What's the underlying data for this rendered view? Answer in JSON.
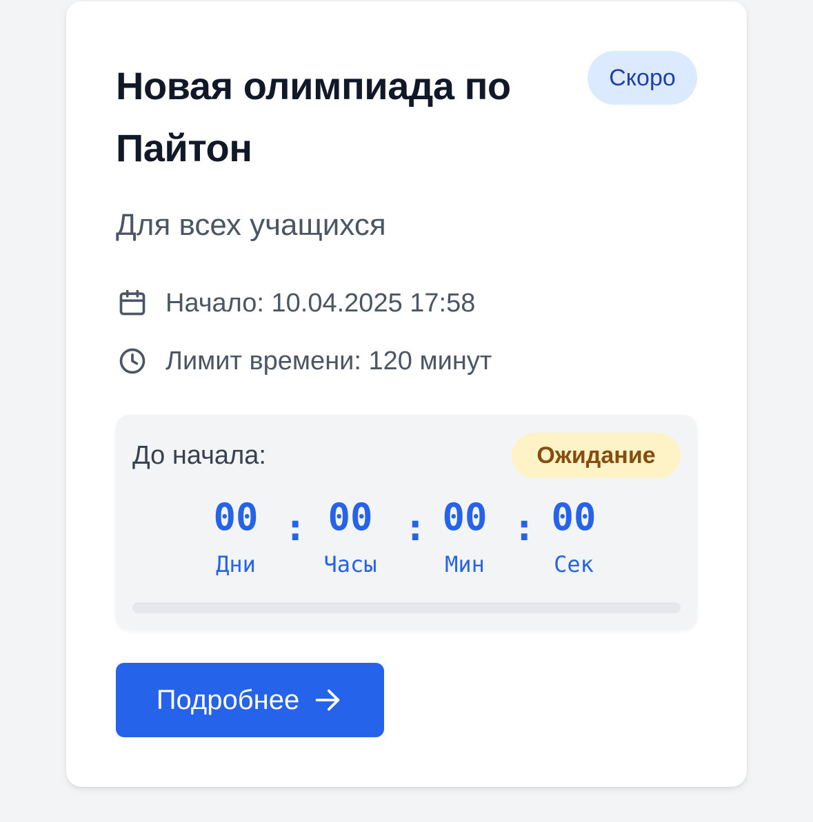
{
  "card": {
    "title": "Новая олимпиада по Пайтон",
    "status_badge": "Скоро",
    "audience": "Для всех учащихся",
    "start": "Начало: 10.04.2025 17:58",
    "time_limit": "Лимит времени: 120 минут",
    "start_icon": "calendar-icon",
    "limit_icon": "clock-icon"
  },
  "countdown": {
    "label": "До начала:",
    "state_badge": "Ожидание",
    "separator": ":",
    "units": [
      {
        "value": "00",
        "label": "Дни"
      },
      {
        "value": "00",
        "label": "Часы"
      },
      {
        "value": "00",
        "label": "Мин"
      },
      {
        "value": "00",
        "label": "Сек"
      }
    ],
    "progress_fraction": 0
  },
  "action": {
    "details_label": "Подробнее",
    "details_icon": "arrow-right-icon"
  },
  "colors": {
    "accent": "#2563eb",
    "soon_badge_bg": "#dbeafe",
    "waiting_badge_bg": "#fef3c7",
    "waiting_badge_text": "#854d0e"
  }
}
